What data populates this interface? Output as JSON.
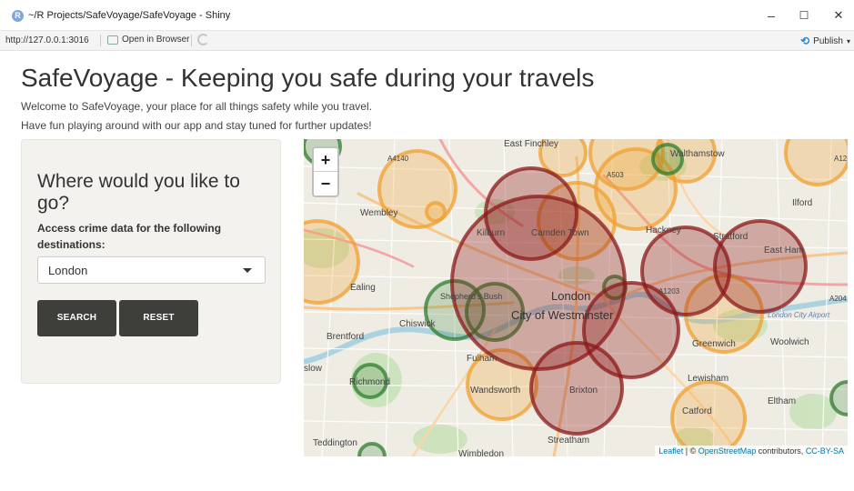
{
  "window": {
    "title": "~/R Projects/SafeVoyage/SafeVoyage - Shiny",
    "icon": "R",
    "minimize": "–",
    "maximize": "☐",
    "close": "✕"
  },
  "addressbar": {
    "url": "http://127.0.0.1:3016",
    "open_in_browser": "Open in Browser",
    "publish": "Publish"
  },
  "page": {
    "title": "SafeVoyage - Keeping you safe during your travels",
    "welcome": "Welcome to SafeVoyage, your place for all things safety while you travel.",
    "tagline": "Have fun playing around with our app and stay tuned for further updates!"
  },
  "sidebar": {
    "heading": "Where would you like to go?",
    "select_label": "Access crime data for the following destinations:",
    "select_value": "London",
    "search_label": "SEARCH",
    "reset_label": "RESET"
  },
  "map": {
    "zoom_in": "+",
    "zoom_out": "−",
    "attribution": {
      "leaflet": "Leaflet",
      "sep": " | © ",
      "osm": "OpenStreetMap",
      "contributors": " contributors, ",
      "license": "CC-BY-SA"
    },
    "labels": {
      "east_finchley": "East Finchley",
      "walthamstow": "Walthamstow",
      "a4140": "A4140",
      "a503": "A503",
      "a12": "A12",
      "wembley": "Wembley",
      "ilford": "Ilford",
      "kilburn": "Kilburn",
      "camden_town": "Camden Town",
      "hackney": "Hackney",
      "stratford": "Stratford",
      "east_ham": "East Ham",
      "ealing": "Ealing",
      "shepherds_bush": "Shepherd's Bush",
      "london": "London",
      "city_of_westminster": "City of Westminster",
      "a1203": "A1203",
      "a204": "A204",
      "london_city_airport": "London City Airport",
      "chiswick": "Chiswick",
      "brentford": "Brentford",
      "fulham": "Fulham",
      "greenwich": "Greenwich",
      "woolwich": "Woolwich",
      "slow": "slow",
      "richmond": "Richmond",
      "lewisham": "Lewisham",
      "wandsworth": "Wandsworth",
      "brixton": "Brixton",
      "eltham": "Eltham",
      "catford": "Catford",
      "teddington": "Teddington",
      "streatham": "Streatham",
      "wimbledon": "Wimbledon"
    },
    "colors": {
      "red": "#8b1a1a",
      "orange": "#f0a030",
      "green": "#2f7d2f"
    }
  }
}
